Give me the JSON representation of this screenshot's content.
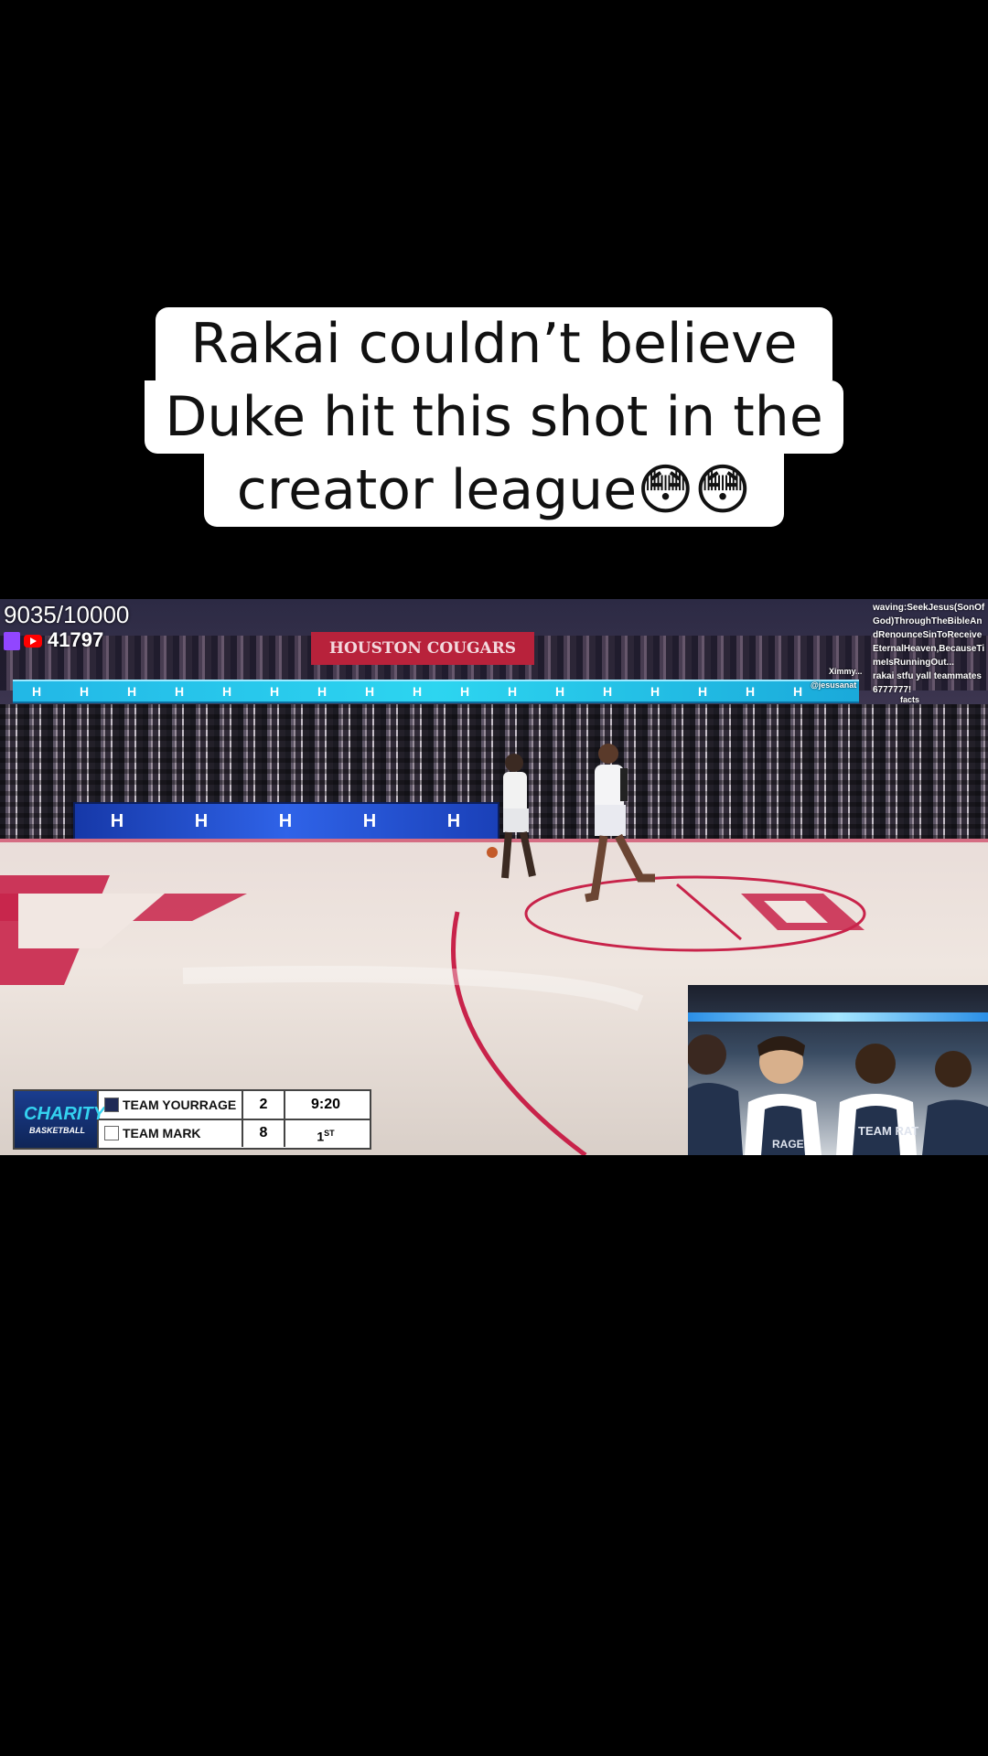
{
  "caption": {
    "line1": "Rakai couldn’t believe",
    "line2": "Duke hit this shot in the",
    "line3": "creator league😳😳"
  },
  "stream": {
    "progress_text": "9035/10000",
    "view_count": "41797"
  },
  "arena": {
    "banner_text": "HOUSTON COUGARS",
    "ribbon_mark": "H"
  },
  "chat": {
    "messages": [
      "waving:SeekJesus(SonOfGod)ThroughTheBibleAndRenounceSinToReceiveEternalHeaven,BecauseTimeIsRunningOut...",
      "rakai stfu yall teammates",
      "6777777!"
    ],
    "handles": [
      "Ximmy...",
      "@jesusanat"
    ],
    "reply": "facts"
  },
  "scoreboard": {
    "logo_text": "CHARITY",
    "logo_sub": "BASKETBALL",
    "teams": [
      {
        "name": "TEAM YOURRAGE",
        "score": "2",
        "color": "#1f2a55"
      },
      {
        "name": "TEAM MARK",
        "score": "8",
        "color": "#ffffff"
      }
    ],
    "clock": "9:20",
    "period": "1",
    "period_suffix": "ST"
  },
  "pip": {
    "jersey_text": "TEAM RAT",
    "jersey_text2": "RAGE"
  }
}
